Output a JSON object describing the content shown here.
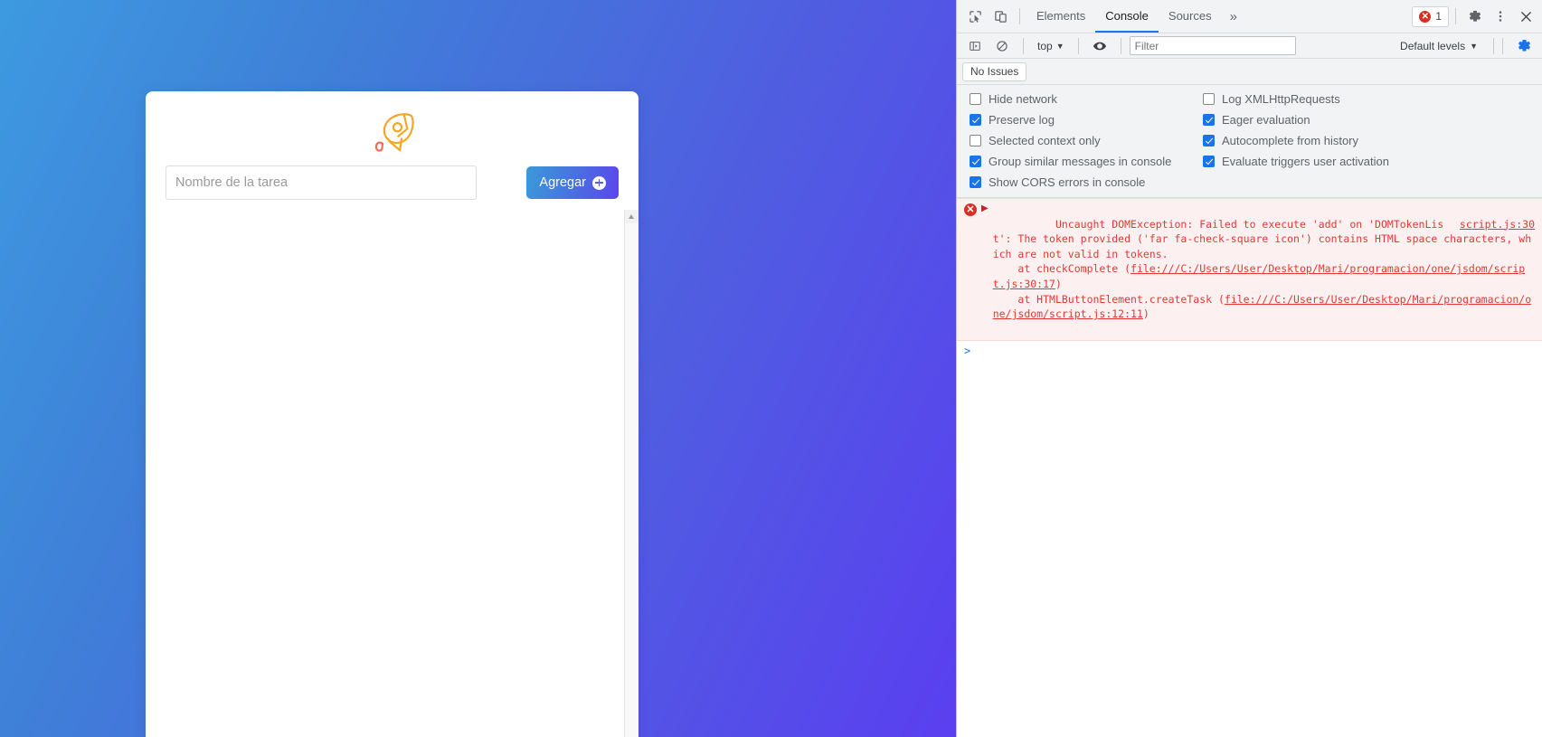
{
  "page": {
    "card": {
      "rocket_icon": "rocket-icon",
      "input_placeholder": "Nombre de la tarea",
      "input_value": "",
      "add_button_label": "Agregar",
      "add_button_icon": "plus-circle-icon"
    },
    "background_colors": {
      "gradient_start": "#3d9ae0",
      "gradient_end": "#5a3ff0"
    },
    "accent_colors": {
      "rocket_orange": "#f5a623",
      "rocket_red": "#ef6c57",
      "button_blue": "#3a9ad9",
      "button_purple": "#5b46ee"
    }
  },
  "devtools": {
    "tabstrip": {
      "inspect_icon": "inspect-element-icon",
      "device_icon": "device-toolbar-icon",
      "tabs": [
        {
          "label": "Elements",
          "active": false
        },
        {
          "label": "Console",
          "active": true
        },
        {
          "label": "Sources",
          "active": false
        }
      ],
      "more_tabs_icon": "chevron-double-right-icon",
      "error_count": "1",
      "error_badge_icon": "error-circle-icon",
      "settings_icon": "gear-icon",
      "more_options_icon": "kebab-menu-icon",
      "close_icon": "close-icon"
    },
    "filterbar": {
      "sidebar_icon": "console-sidebar-icon",
      "clear_icon": "clear-console-icon",
      "context": "top",
      "context_caret": "▼",
      "eye_icon": "live-expression-eye-icon",
      "filter_placeholder": "Filter",
      "filter_value": "",
      "levels_label": "Default levels",
      "levels_caret": "▼",
      "settings_icon": "console-settings-gear-icon"
    },
    "issuesbar": {
      "no_issues_label": "No Issues"
    },
    "settings_panel": {
      "left_column": [
        {
          "label": "Hide network",
          "checked": false
        },
        {
          "label": "Preserve log",
          "checked": true
        },
        {
          "label": "Selected context only",
          "checked": false
        },
        {
          "label": "Group similar messages in console",
          "checked": true
        },
        {
          "label": "Show CORS errors in console",
          "checked": true
        }
      ],
      "right_column": [
        {
          "label": "Log XMLHttpRequests",
          "checked": false
        },
        {
          "label": "Eager evaluation",
          "checked": true
        },
        {
          "label": "Autocomplete from history",
          "checked": true
        },
        {
          "label": "Evaluate triggers user activation",
          "checked": true
        }
      ]
    },
    "console": {
      "error": {
        "icon": "error-circle-icon",
        "expander": "▶",
        "source_link": "script.js:30",
        "message": "Uncaught DOMException: Failed to execute 'add' on 'DOMTokenList': The token provided ('far fa-check-square icon') contains HTML space characters, which are not valid in tokens.",
        "stack": [
          {
            "prefix": "    at checkComplete (",
            "link": "file:///C:/Users/User/Desktop/Mari/programacion/one/jsdom/script.js:30:17",
            "suffix": ")"
          },
          {
            "prefix": "    at HTMLButtonElement.createTask (",
            "link": "file:///C:/Users/User/Desktop/Mari/programacion/one/jsdom/script.js:12:11",
            "suffix": ")"
          }
        ]
      },
      "prompt_symbol": ">",
      "prompt_value": ""
    }
  }
}
